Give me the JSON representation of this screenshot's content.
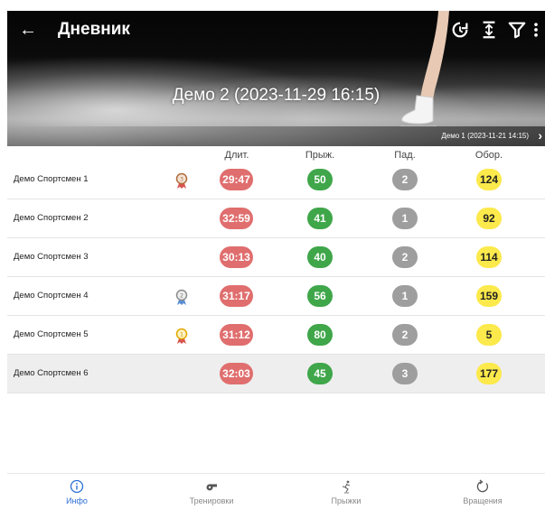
{
  "header": {
    "title": "Дневник",
    "session_title": "Демо 2 (2023-11-29 16:15)",
    "prev_session": "Демо 1 (2023-11-21 14:15)"
  },
  "columns": {
    "duration": "Длит.",
    "jumps": "Прыж.",
    "falls": "Пад.",
    "rotations": "Обор."
  },
  "rows": [
    {
      "athlete": "Демо Спортсмен 1",
      "medal": "bronze",
      "duration": "29:47",
      "jumps": "50",
      "falls": "2",
      "rotations": "124"
    },
    {
      "athlete": "Демо Спортсмен 2",
      "medal": "",
      "duration": "32:59",
      "jumps": "41",
      "falls": "1",
      "rotations": "92"
    },
    {
      "athlete": "Демо Спортсмен 3",
      "medal": "",
      "duration": "30:13",
      "jumps": "40",
      "falls": "2",
      "rotations": "114"
    },
    {
      "athlete": "Демо Спортсмен 4",
      "medal": "silver",
      "duration": "31:17",
      "jumps": "56",
      "falls": "1",
      "rotations": "159"
    },
    {
      "athlete": "Демо Спортсмен 5",
      "medal": "gold",
      "duration": "31:12",
      "jumps": "80",
      "falls": "2",
      "rotations": "5"
    },
    {
      "athlete": "Демо Спортсмен 6",
      "medal": "",
      "duration": "32:03",
      "jumps": "45",
      "falls": "3",
      "rotations": "177"
    }
  ],
  "nav": [
    {
      "label": "Инфо",
      "icon": "info-icon",
      "active": true
    },
    {
      "label": "Тренировки",
      "icon": "whistle-icon",
      "active": false
    },
    {
      "label": "Прыжки",
      "icon": "skater-icon",
      "active": false
    },
    {
      "label": "Вращения",
      "icon": "rotation-icon",
      "active": false
    }
  ],
  "colors": {
    "duration": "#e06e6e",
    "jumps": "#3fa64a",
    "falls": "#9e9e9e",
    "rotations": "#fce94b",
    "active_tab": "#2a6fd6"
  }
}
